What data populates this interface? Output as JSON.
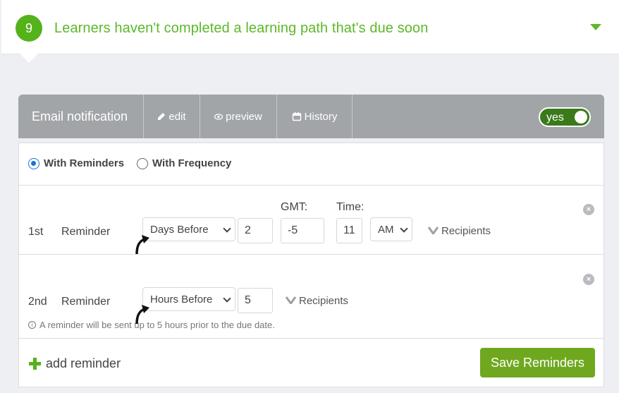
{
  "header": {
    "step_number": "9",
    "title": "Learners haven't completed a learning path that's due soon"
  },
  "notification_bar": {
    "title": "Email notification",
    "edit_label": "edit",
    "preview_label": "preview",
    "history_label": "History",
    "toggle_label": "yes"
  },
  "reminder_mode": {
    "options": [
      {
        "label": "With Reminders",
        "selected": true
      },
      {
        "label": "With Frequency",
        "selected": false
      }
    ]
  },
  "reminders": [
    {
      "ordinal": "1st",
      "label": "Reminder",
      "timing": "Days Before",
      "amount": "2",
      "gmt_label": "GMT:",
      "gmt_value": "-5",
      "time_label": "Time:",
      "time_value": "11",
      "ampm": "AM",
      "recipients_label": "Recipients"
    },
    {
      "ordinal": "2nd",
      "label": "Reminder",
      "timing": "Hours Before",
      "amount": "5",
      "recipients_label": "Recipients",
      "hint": "A reminder will be sent up to 5 hours prior to the due date."
    }
  ],
  "footer": {
    "add_label": "add reminder",
    "save_label": "Save Reminders"
  },
  "colors": {
    "accent_green": "#54b21a",
    "save_green": "#6fa81e",
    "bar_gray": "#a2a5a8",
    "radio_blue": "#1a73d9"
  }
}
